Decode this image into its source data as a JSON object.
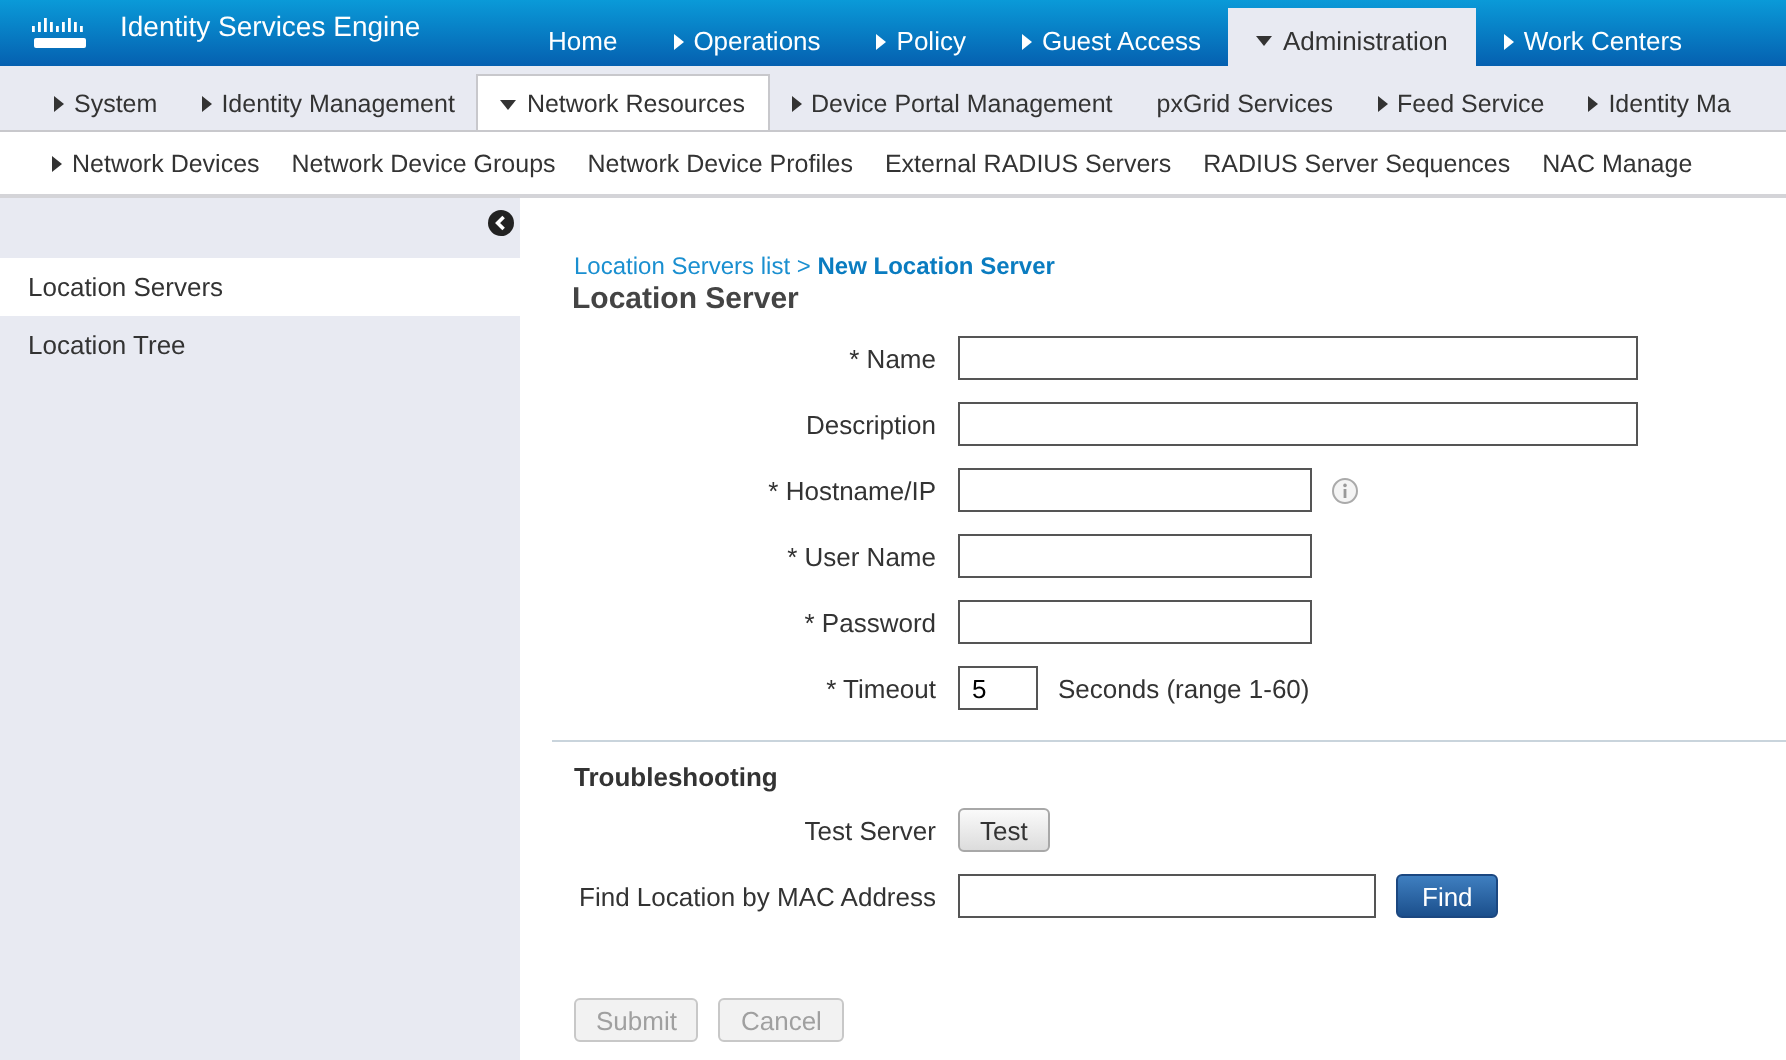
{
  "header": {
    "brand": "Identity Services Engine",
    "tabs": [
      {
        "label": "Home",
        "kind": "link",
        "selected": false
      },
      {
        "label": "Operations",
        "kind": "dropdown",
        "selected": false
      },
      {
        "label": "Policy",
        "kind": "dropdown",
        "selected": false
      },
      {
        "label": "Guest Access",
        "kind": "dropdown",
        "selected": false
      },
      {
        "label": "Administration",
        "kind": "dropdown",
        "selected": true
      },
      {
        "label": "Work Centers",
        "kind": "dropdown",
        "selected": false
      }
    ]
  },
  "subnav": [
    {
      "label": "System",
      "kind": "dropdown",
      "selected": false
    },
    {
      "label": "Identity Management",
      "kind": "dropdown",
      "selected": false
    },
    {
      "label": "Network Resources",
      "kind": "dropdown",
      "selected": true
    },
    {
      "label": "Device Portal Management",
      "kind": "dropdown",
      "selected": false
    },
    {
      "label": "pxGrid Services",
      "kind": "link",
      "selected": false
    },
    {
      "label": "Feed Service",
      "kind": "dropdown",
      "selected": false
    },
    {
      "label": "Identity Ma",
      "kind": "dropdown",
      "selected": false
    }
  ],
  "menu": [
    {
      "label": "Network Devices",
      "kind": "dropdown"
    },
    {
      "label": "Network Device Groups",
      "kind": "link"
    },
    {
      "label": "Network Device Profiles",
      "kind": "link"
    },
    {
      "label": "External RADIUS Servers",
      "kind": "link"
    },
    {
      "label": "RADIUS Server Sequences",
      "kind": "link"
    },
    {
      "label": "NAC Manage",
      "kind": "link"
    }
  ],
  "sidebar": {
    "items": [
      {
        "label": "Location Servers",
        "selected": true
      },
      {
        "label": "Location Tree",
        "selected": false
      }
    ]
  },
  "breadcrumb": {
    "link": "Location Servers list >",
    "current": "New Location Server"
  },
  "form": {
    "title": "Location Server",
    "fields": [
      {
        "label": "* Name",
        "kind": "long"
      },
      {
        "label": "Description",
        "kind": "long"
      },
      {
        "label": "* Hostname/IP",
        "kind": "short",
        "info": true
      },
      {
        "label": "* User Name",
        "kind": "short"
      },
      {
        "label": "* Password",
        "kind": "short"
      },
      {
        "label": "* Timeout",
        "kind": "number",
        "value": "5",
        "suffix": "Seconds (range 1-60)"
      }
    ]
  },
  "troubleshooting": {
    "title": "Troubleshooting",
    "test_label": "Test Server",
    "test_button": "Test",
    "find_label": "Find Location by MAC Address",
    "find_button": "Find"
  },
  "buttons": [
    {
      "label": "Submit",
      "disabled": true
    },
    {
      "label": "Cancel",
      "disabled": true
    }
  ]
}
